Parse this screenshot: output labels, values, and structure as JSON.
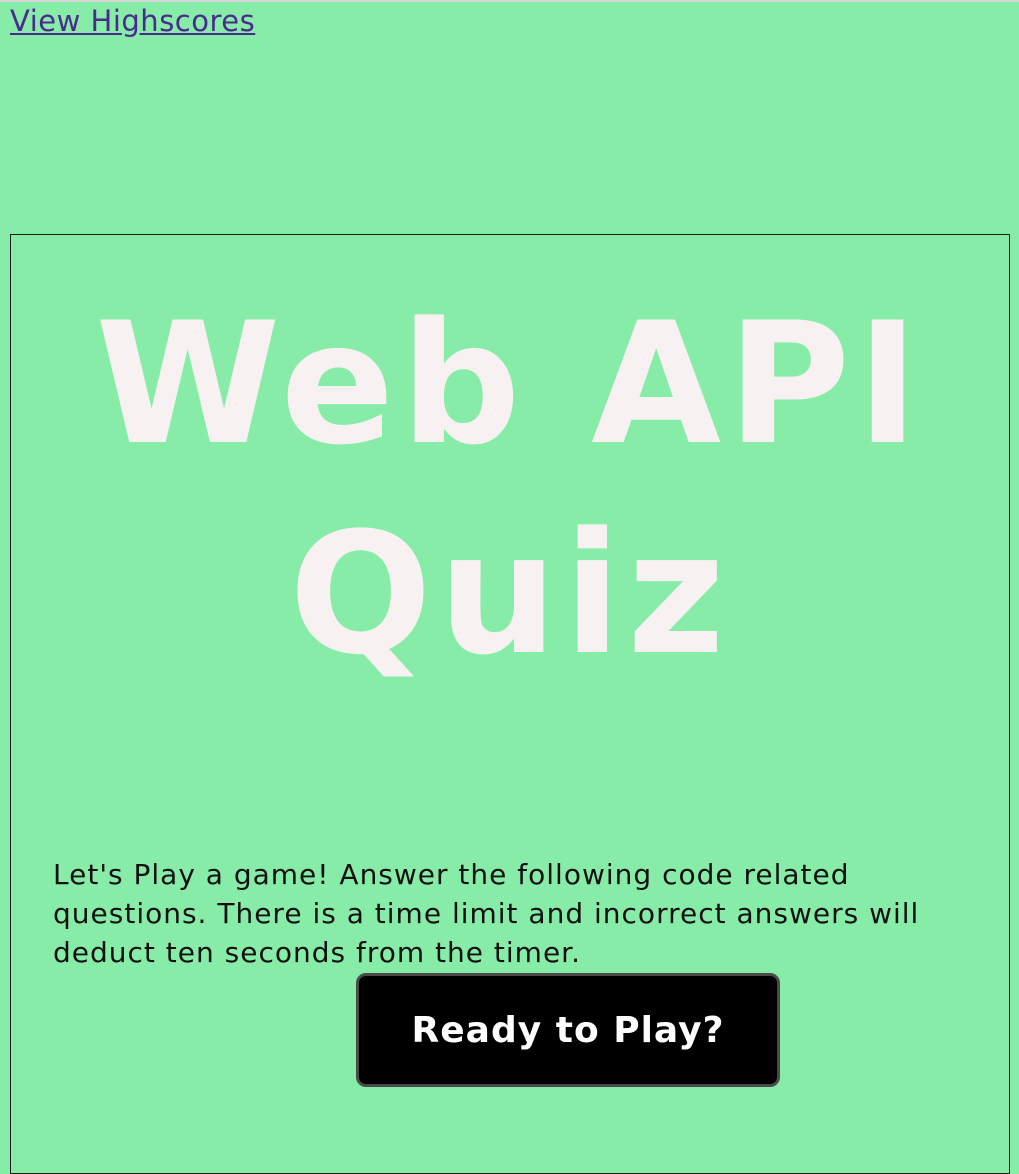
{
  "header": {
    "highscores_link": "View Highscores"
  },
  "main": {
    "title_line1": "Web API",
    "title_line2": "Quiz",
    "intro_text": "Let's Play a game! Answer the following code related questions. There is a time limit and incorrect answers will deduct ten seconds from the timer.",
    "start_button_label": "Ready to Play?"
  },
  "colors": {
    "background": "#86eca8",
    "title": "#f7f2f1",
    "link": "#4b2a8f",
    "button_bg": "#000000",
    "button_text": "#ffffff"
  }
}
